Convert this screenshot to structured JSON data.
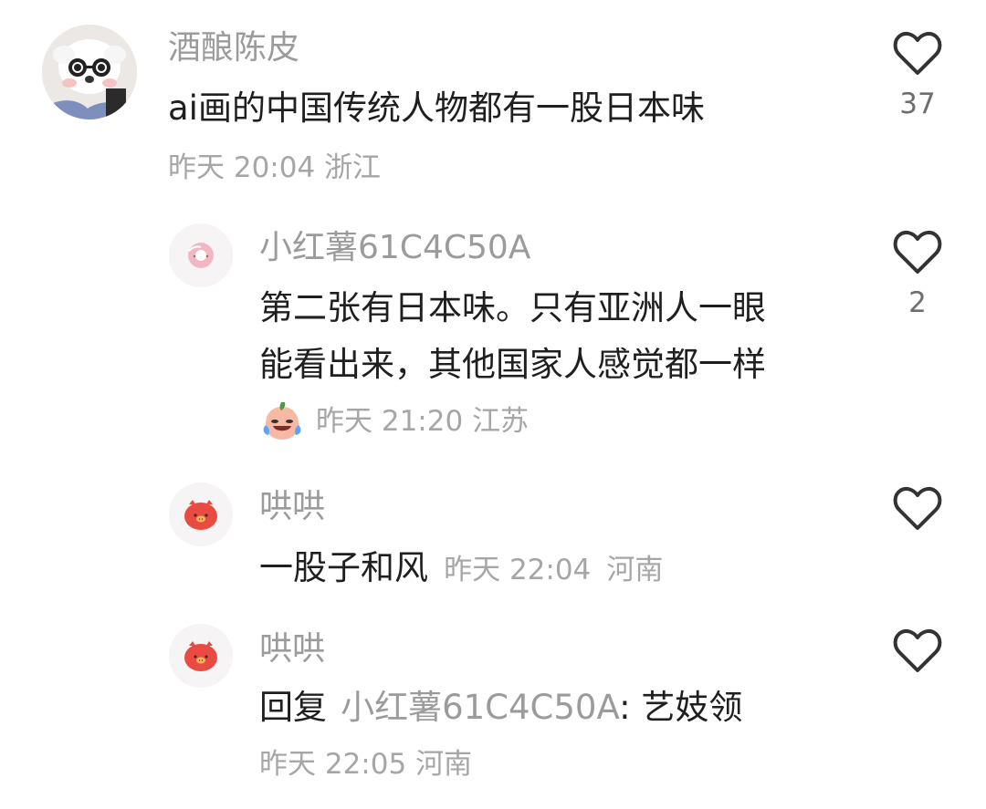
{
  "comments": [
    {
      "username": "酒酿陈皮",
      "text": "ai画的中国传统人物都有一股日本味",
      "time": "昨天 20:04",
      "location": "浙江",
      "likes": "37"
    },
    {
      "username": "小红薯61C4C50A",
      "text_line1": "第二张有日本味。只有亚洲人一眼",
      "text_line2": "能看出来，其他国家人感觉都一样",
      "time": "昨天 21:20",
      "location": "江苏",
      "likes": "2"
    },
    {
      "username": "哄哄",
      "text": "一股子和风",
      "time": "昨天 22:04",
      "location": "河南"
    },
    {
      "username": "哄哄",
      "reply_prefix": "回复",
      "reply_target": "小红薯61C4C50A",
      "text": ": 艺妓领",
      "time": "昨天 22:05",
      "location": "河南"
    }
  ],
  "colors": {
    "username": "#9b9b9b",
    "content": "#1f1f1f",
    "meta": "#a6a6a6",
    "like_outline": "#333333",
    "avatar_pig": "#e94b43"
  },
  "icons": {
    "like": "heart-outline-icon",
    "emoji": "crying-laughing-peach-emoji"
  }
}
